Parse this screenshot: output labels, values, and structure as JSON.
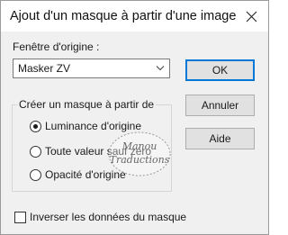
{
  "window": {
    "title": "Ajout d'un masque à partir d'une image",
    "close_icon": "close-icon"
  },
  "source": {
    "label": "Fenêtre d'origine :",
    "selected": "Masker ZV",
    "dropdown_icon": "chevron-down-icon"
  },
  "group": {
    "legend": "Créer un masque à partir de",
    "options": [
      {
        "label": "Luminance d'origine",
        "checked": true
      },
      {
        "label": "Toute valeur sauf zéro",
        "checked": false
      },
      {
        "label": "Opacité d'origine",
        "checked": false
      }
    ]
  },
  "buttons": {
    "ok": "OK",
    "cancel": "Annuler",
    "help": "Aide"
  },
  "invert": {
    "label": "Inverser les données du masque",
    "checked": false
  },
  "watermark": {
    "line1": "Manou",
    "line2": "Traductions"
  },
  "colors": {
    "accent": "#0078d7",
    "dialog_bg": "#f0f0f0"
  }
}
